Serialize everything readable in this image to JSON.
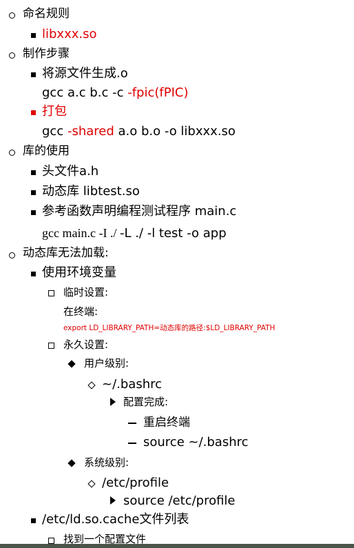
{
  "outline": {
    "s1": "命名规则",
    "s1_item": "libxxx.so",
    "s2": "制作步骤",
    "s2_item1": "将源文件生成.o",
    "s2_cmd1_a": "gcc a.c b.c -c ",
    "s2_cmd1_b": "-fpic(fPIC)",
    "s2_item2": "打包",
    "s2_cmd2_a": "gcc ",
    "s2_cmd2_b": "-shared",
    "s2_cmd2_c": " a.o b.o -o libxxx.so",
    "s3": "库的使用",
    "s3_item1": "头文件a.h",
    "s3_item2": "动态库 libtest.so",
    "s3_item3": "参考函数声明编程测试程序 main.c",
    "s3_cmd_a": "gcc main.c -I ./  ",
    "s3_cmd_b": "-L ./ -l test -o app",
    "s4": "动态库无法加载:",
    "s4_item1": "使用环境变量",
    "temp": "临时设置:",
    "terminal": "在终端:",
    "export_cmd": "export LD_LIBRARY_PATH=动态库的路径:$LD_LIBRARY_PATH",
    "perm": "永久设置:",
    "user_level": "用户级别:",
    "bashrc": "~/.bashrc",
    "config_done": "配置完成:",
    "restart": "重启终端",
    "source_bashrc": "source ~/.bashrc",
    "system_level": "系统级别:",
    "etc_profile": "/etc/profile",
    "source_profile": "source /etc/profile",
    "s4_item2": "/etc/ld.so.cache文件列表",
    "find_config": "找到一个配置文件"
  },
  "colors": {
    "accent": "#e00000",
    "footer": "#4a5548"
  }
}
